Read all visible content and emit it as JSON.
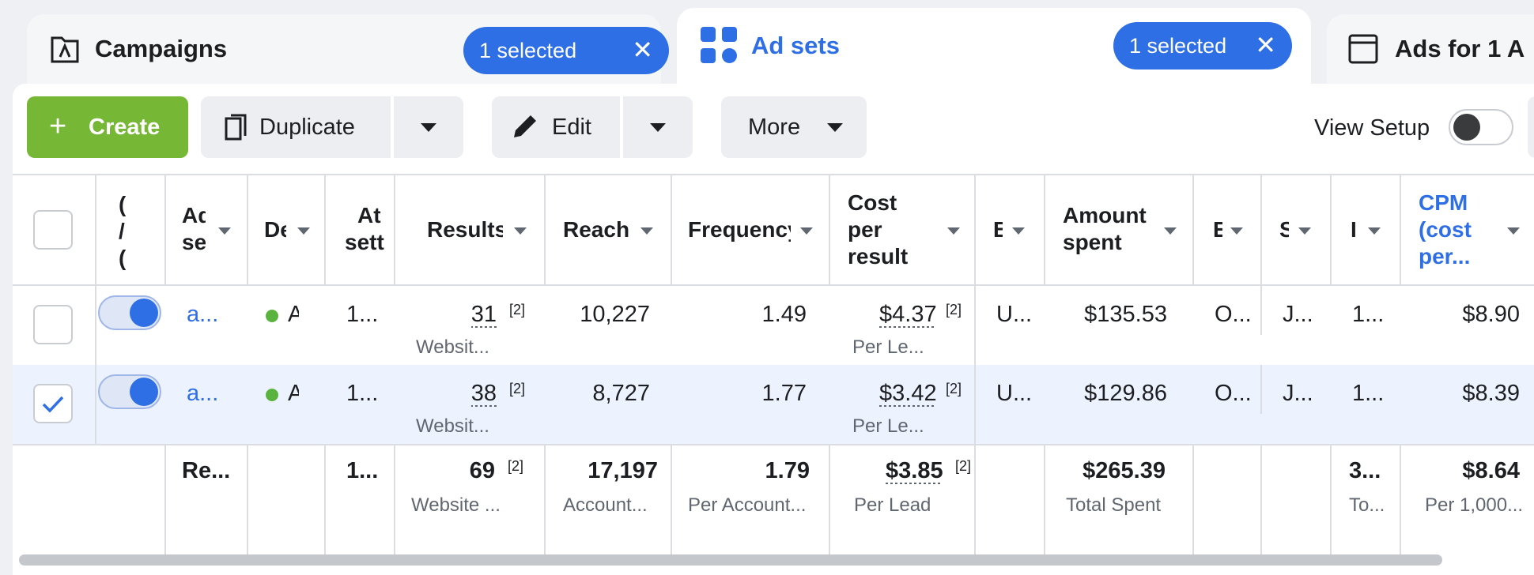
{
  "tabs": {
    "campaigns": {
      "label": "Campaigns",
      "selected": "1 selected",
      "icon": "campaign-flag-icon"
    },
    "adsets": {
      "label": "Ad sets",
      "selected": "1 selected",
      "icon": "grid-icon"
    },
    "ads": {
      "label": "Ads for 1 A",
      "icon": "ad-window-icon"
    }
  },
  "toolbar": {
    "create": "Create",
    "duplicate": "Duplicate",
    "edit": "Edit",
    "more": "More",
    "view_setup": "View Setup",
    "view_setup_on": false
  },
  "table": {
    "headers": {
      "off_on": [
        "(",
        "/",
        "("
      ],
      "adset": [
        "Ad",
        "se"
      ],
      "delivery": "De",
      "attribution": [
        "At",
        "sett"
      ],
      "results": "Results",
      "reach": "Reach",
      "frequency": "Frequency",
      "cost_per_result": [
        "Cost",
        "per",
        "result"
      ],
      "budget": "B",
      "amount_spent": [
        "Amount",
        "spent"
      ],
      "ends": "E",
      "schedule": "S",
      "impressions": "I",
      "cpm": [
        "CPM",
        "(cost",
        "per..."
      ]
    },
    "rows": [
      {
        "checked": false,
        "on": true,
        "name": "a...",
        "delivery": "A",
        "attribution": "1...",
        "results": "31",
        "results_ref": "[2]",
        "results_sub": "Websit...",
        "reach": "10,227",
        "frequency": "1.49",
        "cost": "$4.37",
        "cost_ref": "[2]",
        "cost_sub": "Per Le...",
        "budget": "U...",
        "spent": "$135.53",
        "ends": "O...",
        "schedule": "J...",
        "impressions": "1...",
        "cpm": "$8.90"
      },
      {
        "checked": true,
        "on": true,
        "name": "a...",
        "delivery": "A",
        "attribution": "1...",
        "results": "38",
        "results_ref": "[2]",
        "results_sub": "Websit...",
        "reach": "8,727",
        "frequency": "1.77",
        "cost": "$3.42",
        "cost_ref": "[2]",
        "cost_sub": "Per Le...",
        "budget": "U...",
        "spent": "$129.86",
        "ends": "O...",
        "schedule": "J...",
        "impressions": "1...",
        "cpm": "$8.39"
      }
    ],
    "totals": {
      "name": "Re...",
      "attribution": "1...",
      "results": "69",
      "results_ref": "[2]",
      "results_sub": "Website ...",
      "reach": "17,197",
      "reach_sub": "Account...",
      "frequency": "1.79",
      "frequency_sub": "Per Account...",
      "cost": "$3.85",
      "cost_ref": "[2]",
      "cost_sub": "Per Lead",
      "spent": "$265.39",
      "spent_sub": "Total Spent",
      "impressions": "3...",
      "impressions_sub": "To...",
      "cpm": "$8.64",
      "cpm_sub": "Per 1,000..."
    }
  },
  "colors": {
    "accent": "#2f6fe6",
    "create": "#76b735",
    "selected_row": "#ecf3ff"
  }
}
